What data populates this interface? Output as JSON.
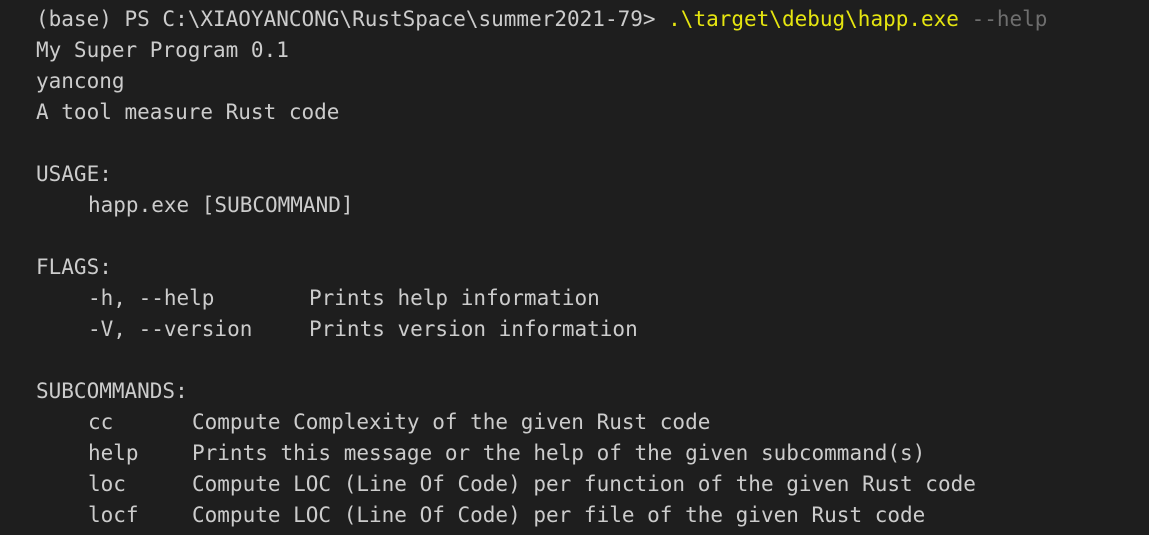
{
  "prompt": {
    "text": "(base) PS C:\\XIAOYANCONG\\RustSpace\\summer2021-79> ",
    "command": ".\\target\\debug\\happ.exe",
    "args": " --help"
  },
  "header": {
    "name_version": "My Super Program 0.1",
    "author": "yancong",
    "about": "A tool measure Rust code"
  },
  "usage": {
    "heading": "USAGE:",
    "line": "happ.exe [SUBCOMMAND]"
  },
  "flags": {
    "heading": "FLAGS:",
    "items": [
      {
        "flag": "-h, --help",
        "desc": "Prints help information"
      },
      {
        "flag": "-V, --version",
        "desc": "Prints version information"
      }
    ]
  },
  "subcommands": {
    "heading": "SUBCOMMANDS:",
    "items": [
      {
        "name": "cc",
        "desc": "Compute Complexity of the given Rust code"
      },
      {
        "name": "help",
        "desc": "Prints this message or the help of the given subcommand(s)"
      },
      {
        "name": "loc",
        "desc": "Compute LOC (Line Of Code) per function of the given Rust code"
      },
      {
        "name": "locf",
        "desc": "Compute LOC (Line Of Code) per file of the given Rust code"
      }
    ]
  },
  "colors": {
    "background": "#1e1e1e",
    "foreground": "#cccccc",
    "command": "#e5e510",
    "parameter": "#6e6e6e"
  }
}
